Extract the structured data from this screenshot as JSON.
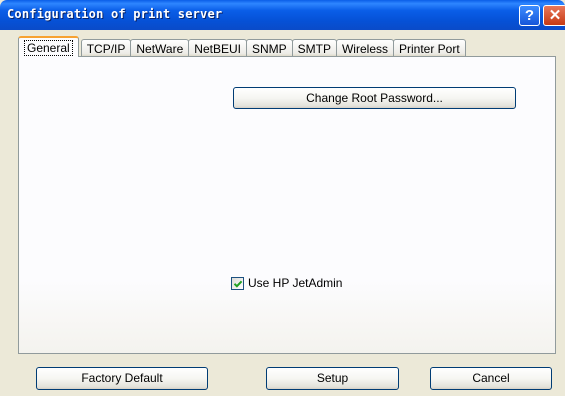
{
  "window": {
    "title": "Configuration of print server",
    "help_glyph": "?",
    "close_glyph": "✕"
  },
  "tabs": [
    {
      "label": "General",
      "active": true
    },
    {
      "label": "TCP/IP"
    },
    {
      "label": "NetWare"
    },
    {
      "label": "NetBEUI"
    },
    {
      "label": "SNMP"
    },
    {
      "label": "SMTP"
    },
    {
      "label": "Wireless"
    },
    {
      "label": "Printer Port"
    }
  ],
  "general": {
    "change_root_password_label": "Change Root Password...",
    "use_jetadmin_label": "Use HP JetAdmin",
    "use_jetadmin_checked": true
  },
  "buttons": {
    "factory_default": "Factory Default",
    "setup": "Setup",
    "cancel": "Cancel"
  },
  "colors": {
    "titlebar": "#0A5EE8",
    "face": "#ECE9D8",
    "tab_highlight": "#F7A233",
    "check": "#21A121"
  }
}
